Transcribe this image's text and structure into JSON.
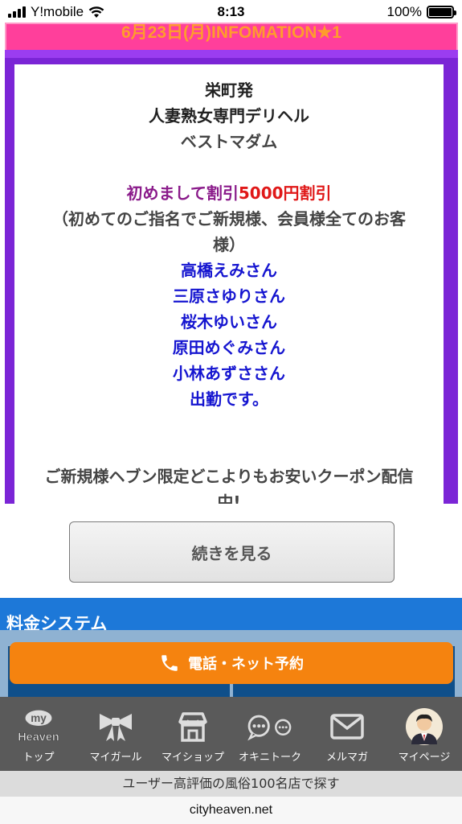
{
  "status_bar": {
    "carrier": "Y!mobile",
    "time": "8:13",
    "battery": "100%"
  },
  "banner": {
    "text": "6月23日(月)INFOMATION★1"
  },
  "notice": {
    "line1": "栄町発",
    "line2": "人妻熟女専門デリヘル",
    "line3": "ベストマダム",
    "discount_label": "初めまして割引",
    "discount_value": "5000円割引",
    "condition_line1": "（初めてのご指名でご新規様、会員様全てのお客",
    "condition_line2": "様）",
    "names": [
      "高橋えみさん",
      "三原さゆりさん",
      "桜木ゆいさん",
      "原田めぐみさん",
      "小林あずささん"
    ],
    "attendance": "出勤です。",
    "coupon_line1": "ご新規様ヘブン限定どこよりもお安いクーポン配信",
    "coupon_line2": "中!"
  },
  "more_button": {
    "label": "続きを見る"
  },
  "price_system": {
    "title": "料金システム"
  },
  "reserve_button": {
    "label": "電話・ネット予約"
  },
  "tabbar": {
    "items": [
      {
        "label": "トップ",
        "icon": "myheaven-logo-icon",
        "logo_top": "my",
        "logo_bottom": "Heaven"
      },
      {
        "label": "マイガール",
        "icon": "ribbon-icon"
      },
      {
        "label": "マイショップ",
        "icon": "shop-icon"
      },
      {
        "label": "オキニトーク",
        "icon": "chat-bubbles-icon"
      },
      {
        "label": "メルマガ",
        "icon": "mail-icon"
      },
      {
        "label": "マイページ",
        "icon": "user-avatar-icon"
      }
    ]
  },
  "footer": {
    "search_text": "ユーザー高評価の風俗100名店で探す",
    "url": "cityheaven.net"
  },
  "colors": {
    "pink_banner": "#ff3f9b",
    "purple_frame": "#7b25d6",
    "orange_button": "#f5830f",
    "blue_section": "#1d78d8",
    "tabbar": "#5a5a5a"
  }
}
